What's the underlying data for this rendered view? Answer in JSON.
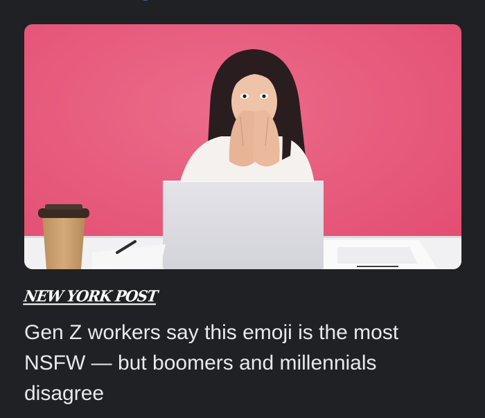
{
  "article": {
    "image_alt": "Woman covering her mouth in shock while looking at a laptop on a pink background",
    "source": "NEW YORK POST",
    "headline": "Gen Z workers say this emoji is the most NSFW — but boomers and millennials disagree"
  },
  "colors": {
    "background": "#202124",
    "headline_text": "#e8eaed",
    "hero_pink": "#e9587a"
  }
}
